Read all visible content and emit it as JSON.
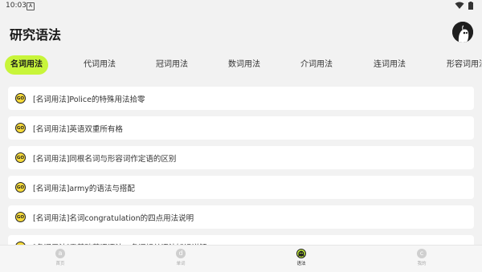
{
  "status_bar": {
    "time": "10:03",
    "notification_letter": "A"
  },
  "header": {
    "title": "研究语法"
  },
  "tabs": [
    {
      "label": "名词用法",
      "active": true
    },
    {
      "label": "代词用法",
      "active": false
    },
    {
      "label": "冠词用法",
      "active": false
    },
    {
      "label": "数词用法",
      "active": false
    },
    {
      "label": "介词用法",
      "active": false
    },
    {
      "label": "连词用法",
      "active": false
    },
    {
      "label": "形容词用法",
      "active": false
    }
  ],
  "list": {
    "badge": "GO",
    "items": [
      {
        "text": "[名词用法]Police的特殊用法拾零"
      },
      {
        "text": "[名词用法]英语双重所有格"
      },
      {
        "text": "[名词用法]同根名词与形容词作定语的区别"
      },
      {
        "text": "[名词用法]army的语法与搭配"
      },
      {
        "text": "[名词用法]名词congratulation的四点用法说明"
      },
      {
        "text": "[名词用法]零基础英语语法：名词相关语法知识详解"
      }
    ]
  },
  "bottom_nav": [
    {
      "icon": "a",
      "label": "首页",
      "active": false
    },
    {
      "icon": "d",
      "label": "单词",
      "active": false
    },
    {
      "icon": "",
      "label": "语法",
      "active": true
    },
    {
      "icon": "c",
      "label": "我的",
      "active": false
    }
  ],
  "colors": {
    "accent": "#c8f53a",
    "badge": "#f5d93a",
    "background": "#f2f2f2"
  }
}
